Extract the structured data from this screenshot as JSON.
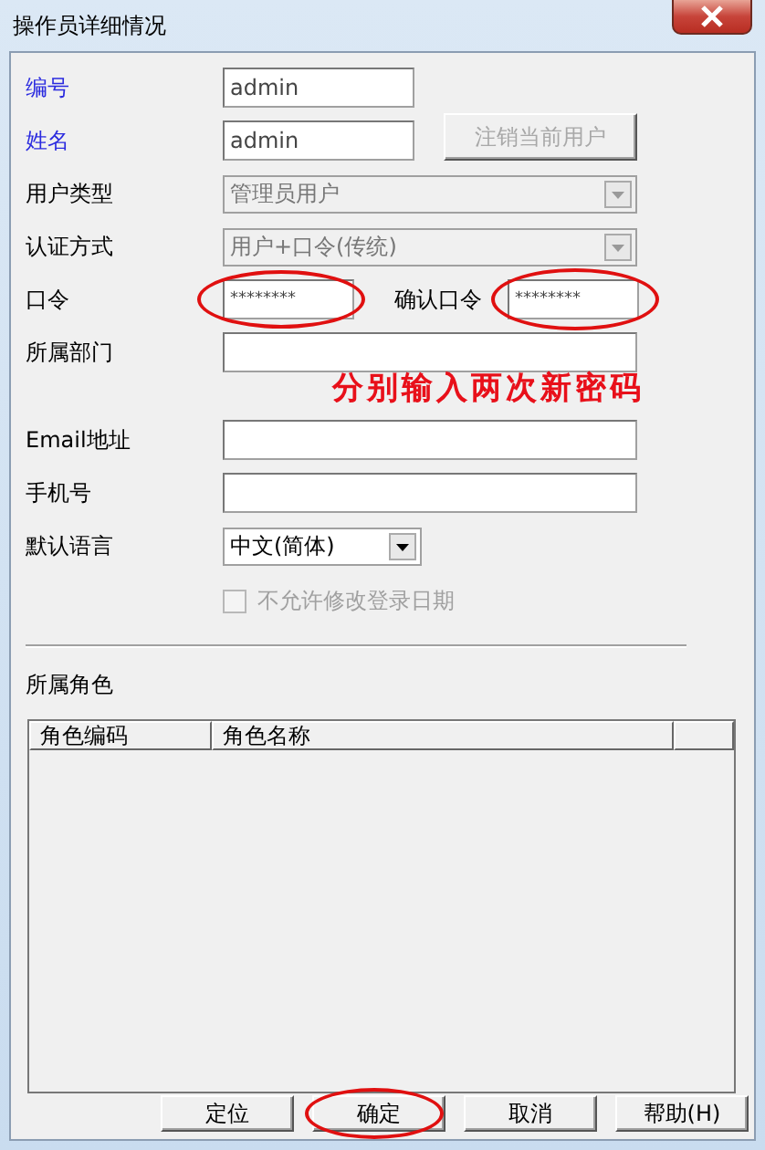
{
  "window": {
    "title": "操作员详细情况"
  },
  "fields": [
    {
      "kind": "short",
      "label": "编号",
      "required": true,
      "value": "admin"
    },
    {
      "kind": "short",
      "label": "姓名",
      "required": true,
      "value": "admin",
      "button": {
        "label": "注销当前用户",
        "disabled": true
      }
    },
    {
      "kind": "combo",
      "label": "用户类型",
      "required": false,
      "value": "管理员用户",
      "disabled": true
    },
    {
      "kind": "combo",
      "label": "认证方式",
      "required": false,
      "value": "用户+口令(传统)",
      "disabled": true
    },
    {
      "kind": "password",
      "label": "口令",
      "required": false,
      "value": "********",
      "circled": true,
      "confirm": {
        "label": "确认口令",
        "value": "********",
        "circled": true
      }
    },
    {
      "kind": "text",
      "label": "所属部门",
      "required": false,
      "annotation": "分别输入两次新密码"
    },
    {
      "kind": "text",
      "label": "Email地址",
      "required": false
    },
    {
      "kind": "text",
      "label": "手机号",
      "required": false
    },
    {
      "kind": "dropdown",
      "label": "默认语言",
      "required": false,
      "value": "中文(简体)",
      "disabled": false
    },
    {
      "kind": "checkbox",
      "label": "不允许修改登录日期",
      "checked": false,
      "disabled": true
    }
  ],
  "roles": {
    "title": "所属角色",
    "columns": [
      "角色编码",
      "角色名称"
    ]
  },
  "buttons": [
    {
      "label": "定位",
      "circled": false
    },
    {
      "label": "确定",
      "circled": true
    },
    {
      "label": "取消",
      "circled": false
    },
    {
      "label": "帮助(H)",
      "circled": false
    }
  ]
}
